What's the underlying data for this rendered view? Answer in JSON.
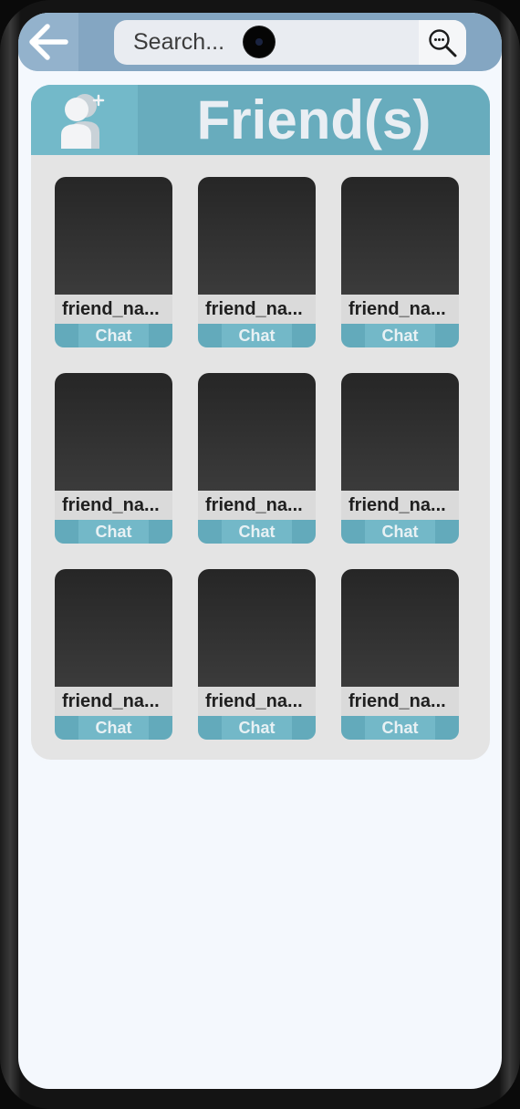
{
  "search": {
    "placeholder": "Search..."
  },
  "icons": {
    "back": "arrow-left-icon",
    "search": "magnifier-icon",
    "add_friend": "add-friend-icon"
  },
  "colors": {
    "topbar": "#84a6c2",
    "header": "#68acbd",
    "header_icon_bg": "#73b9c9",
    "chat_button": "#73b8c8",
    "panel_bg": "#e4e4e4",
    "screen_bg": "#f4f8fd"
  },
  "panel": {
    "title": "Friend(s)"
  },
  "friends": [
    {
      "name": "friend_na...",
      "chat_label": "Chat"
    },
    {
      "name": "friend_na...",
      "chat_label": "Chat"
    },
    {
      "name": "friend_na...",
      "chat_label": "Chat"
    },
    {
      "name": "friend_na...",
      "chat_label": "Chat"
    },
    {
      "name": "friend_na...",
      "chat_label": "Chat"
    },
    {
      "name": "friend_na...",
      "chat_label": "Chat"
    },
    {
      "name": "friend_na...",
      "chat_label": "Chat"
    },
    {
      "name": "friend_na...",
      "chat_label": "Chat"
    },
    {
      "name": "friend_na...",
      "chat_label": "Chat"
    }
  ]
}
